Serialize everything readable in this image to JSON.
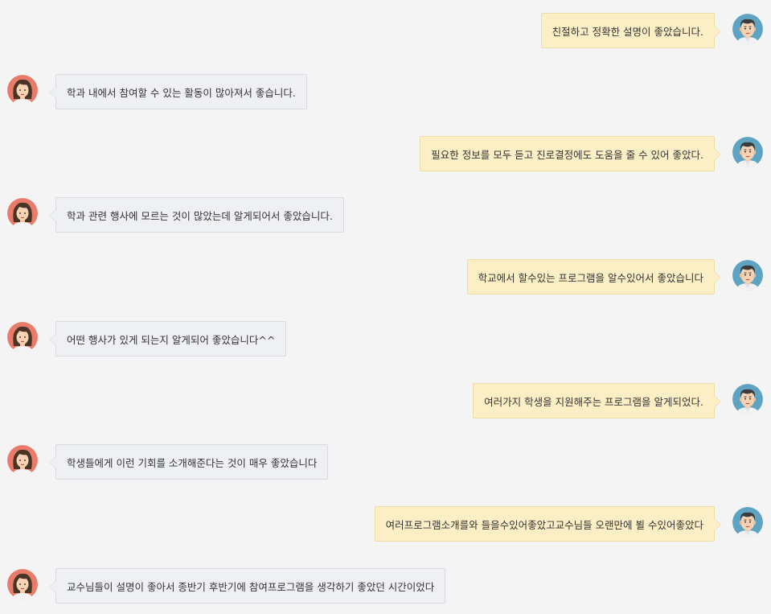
{
  "colors": {
    "background": "#f4f4f4",
    "right_bubble": "#fcefc6",
    "left_bubble": "#eef0f4",
    "male_avatar_bg": "#5ea3c1",
    "female_avatar_bg": "#e87b6a"
  },
  "avatars": {
    "right": "male-avatar-icon",
    "left": "female-avatar-icon"
  },
  "messages": [
    {
      "side": "right",
      "text": "친절하고 정확한 설명이 좋았습니다."
    },
    {
      "side": "left",
      "text": "학과 내에서 참여할 수 있는 활동이 많아져서 좋습니다."
    },
    {
      "side": "right",
      "text": "필요한 정보를 모두 듣고 진로결정에도 도움을 줄 수 있어 좋았다."
    },
    {
      "side": "left",
      "text": "학과 관련 행사에 모르는 것이 많았는데 알게되어서 좋았습니다."
    },
    {
      "side": "right",
      "text": "학교에서 할수있는 프로그램을 알수있어서 좋았습니다"
    },
    {
      "side": "left",
      "text": "어떤 행사가 있게 되는지 알게되어 좋았습니다^^"
    },
    {
      "side": "right",
      "text": "여러가지 학생을 지원해주는 프로그램을 알게되었다."
    },
    {
      "side": "left",
      "text": "학생들에게 이런 기회를 소개해준다는 것이 매우 좋았습니다"
    },
    {
      "side": "right",
      "text": "여러프로그램소개를와 들을수있어좋았고교수님들 오랜만에 뵐 수있어좋았다"
    },
    {
      "side": "left",
      "text": "교수님들이 설명이 좋아서 종반기 후반기에 참여프로그램을 생각하기 좋았던 시간이었다"
    }
  ]
}
